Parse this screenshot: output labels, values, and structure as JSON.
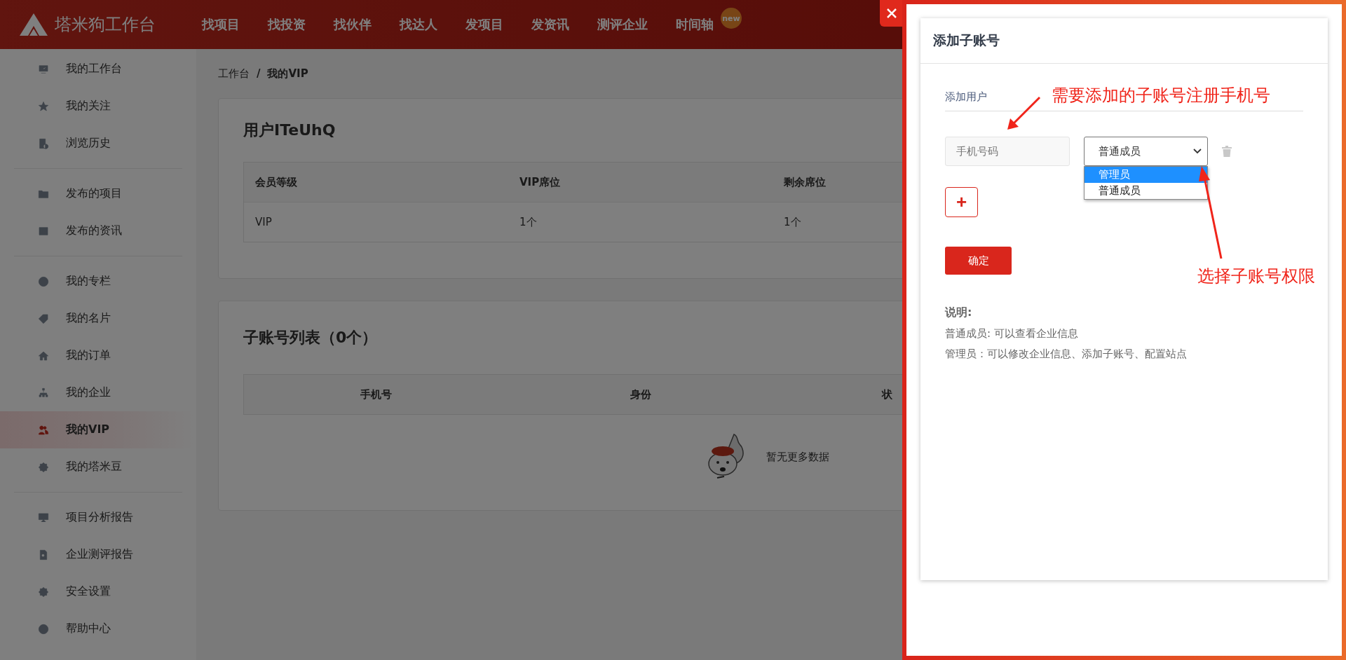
{
  "top_bar": {
    "logo_text": "塔米狗工作台",
    "nav": [
      {
        "label": "找项目"
      },
      {
        "label": "找投资"
      },
      {
        "label": "找伙伴"
      },
      {
        "label": "找达人"
      },
      {
        "label": "发项目"
      },
      {
        "label": "发资讯"
      },
      {
        "label": "测评企业"
      },
      {
        "label": "时间轴",
        "badge": "new"
      }
    ]
  },
  "sidebar": {
    "groups": [
      [
        {
          "label": "我的工作台",
          "selected": false
        },
        {
          "label": "我的关注",
          "selected": false
        },
        {
          "label": "浏览历史",
          "selected": false
        }
      ],
      [
        {
          "label": "发布的项目",
          "selected": false
        },
        {
          "label": "发布的资讯",
          "selected": false
        }
      ],
      [
        {
          "label": "我的专栏",
          "selected": false
        },
        {
          "label": "我的名片",
          "selected": false
        },
        {
          "label": "我的订单",
          "selected": false
        },
        {
          "label": "我的企业",
          "selected": false
        },
        {
          "label": "我的VIP",
          "selected": true
        },
        {
          "label": "我的塔米豆",
          "selected": false
        }
      ],
      [
        {
          "label": "项目分析报告",
          "selected": false
        },
        {
          "label": "企业测评报告",
          "selected": false
        },
        {
          "label": "安全设置",
          "selected": false
        },
        {
          "label": "帮助中心",
          "selected": false
        }
      ]
    ]
  },
  "breadcrumb": [
    "工作台",
    "/",
    "我的VIP"
  ],
  "vip_card": {
    "title": "用户ITeUhQ",
    "columns": [
      "会员等级",
      "VIP席位",
      "剩余席位"
    ],
    "rows": [
      [
        "VIP",
        "1个",
        "1个"
      ]
    ]
  },
  "subaccount_card": {
    "title": "子账号列表（0个）",
    "columns": [
      "手机号",
      "身份",
      "状"
    ],
    "empty_text": "暂无更多数据"
  },
  "drawer": {
    "title": "添加子账号",
    "section_label": "添加用户",
    "phone_placeholder": "手机号码",
    "role_value": "普通成员",
    "role_options": [
      {
        "label": "管理员",
        "selected": true
      },
      {
        "label": "普通成员",
        "selected": false
      }
    ],
    "add_button": "+",
    "confirm_button": "确定",
    "notes_title": "说明:",
    "notes": [
      "普通成员: 可以查看企业信息",
      "管理员：可以修改企业信息、添加子账号、配置站点"
    ]
  },
  "annotations": [
    {
      "text": "需要添加的子账号注册手机号"
    },
    {
      "text": "选择子账号权限"
    }
  ]
}
